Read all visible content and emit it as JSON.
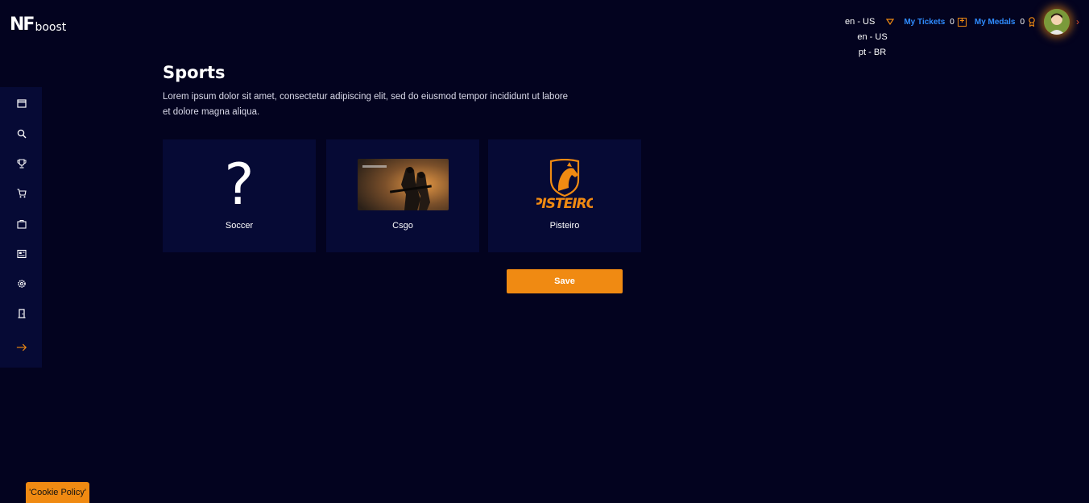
{
  "brand": {
    "logo_main": "NF",
    "logo_sub": "boost"
  },
  "header": {
    "language": {
      "current": "en - US",
      "options": [
        "en - US",
        "pt - BR"
      ]
    },
    "tickets": {
      "label": "My Tickets",
      "count": "0"
    },
    "medals": {
      "label": "My Medals",
      "count": "0"
    }
  },
  "sidebar": {
    "items": [
      {
        "icon": "calendar-icon"
      },
      {
        "icon": "search-icon"
      },
      {
        "icon": "trophy-icon"
      },
      {
        "icon": "cart-icon"
      },
      {
        "icon": "bag-icon"
      },
      {
        "icon": "news-icon"
      },
      {
        "icon": "gear-icon"
      },
      {
        "icon": "door-icon"
      },
      {
        "icon": "arrow-right-icon"
      }
    ]
  },
  "main": {
    "title": "Sports",
    "description": "Lorem ipsum dolor sit amet, consectetur adipiscing elit, sed do eiusmod tempor incididunt ut labore et dolore magna aliqua.",
    "cards": [
      {
        "label": "Soccer",
        "image": "question-mark-icon"
      },
      {
        "label": "Csgo",
        "image": "csgo-image"
      },
      {
        "label": "Pisteiro",
        "image": "pisteiro-logo",
        "logo_text": "PISTEIRO"
      }
    ],
    "save_label": "Save"
  },
  "cookie": {
    "label": "'Cookie Policy'"
  },
  "colors": {
    "background": "#03031f",
    "panel": "#060a35",
    "accent": "#f08a12",
    "link": "#2f8cff"
  }
}
